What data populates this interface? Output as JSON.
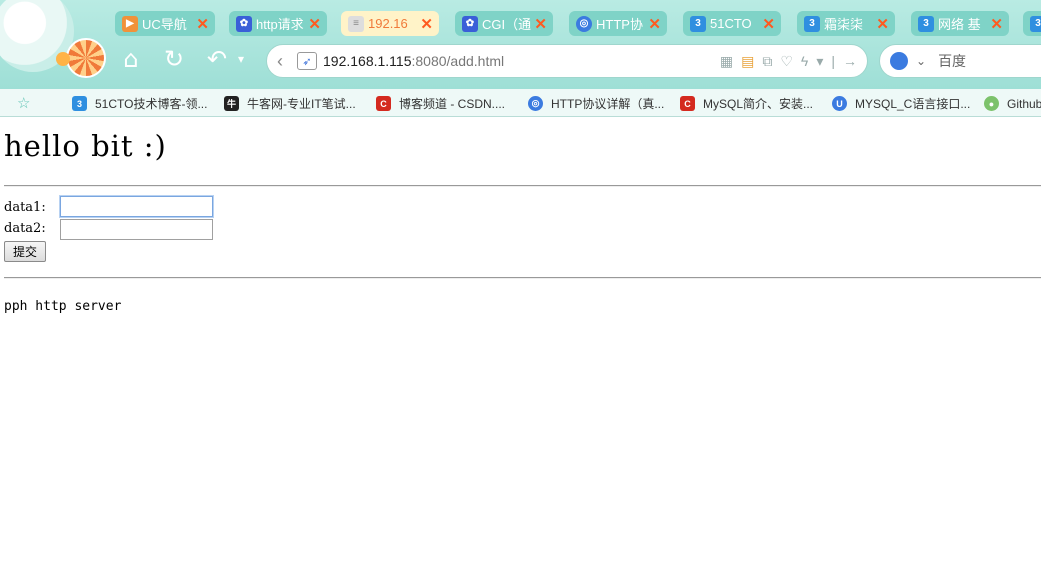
{
  "browser": {
    "tabs": [
      {
        "label": "UC导航",
        "icon": "uc-nav-icon",
        "color": "#f0923a",
        "active": false
      },
      {
        "label": "http请求",
        "icon": "baidu-paw-icon",
        "color": "#3a5fd8",
        "active": false
      },
      {
        "label": "192.16",
        "icon": "page-loading-icon",
        "color": "#dddddd",
        "active": true
      },
      {
        "label": "CGI（通",
        "icon": "baidu-paw-icon",
        "color": "#3a5fd8",
        "active": false
      },
      {
        "label": "HTTP协",
        "icon": "globe-icon",
        "color": "#3b7be0",
        "active": false
      },
      {
        "label": "51CTO",
        "icon": "cto-icon",
        "color": "#2f8fe0",
        "active": false
      },
      {
        "label": "霜柒柒",
        "icon": "cto-icon",
        "color": "#2f8fe0",
        "active": false
      },
      {
        "label": "网络 基",
        "icon": "cto-icon",
        "color": "#2f8fe0",
        "active": false
      }
    ],
    "tab_close_glyph": "✕",
    "address": {
      "host": "192.168.1.115",
      "rest": ":8080/add.html"
    },
    "search": {
      "engine": "百度"
    },
    "bookmarks": [
      {
        "label": "51CTO技术博客-领...",
        "icon": "cto-icon",
        "color": "#2f8fe0"
      },
      {
        "label": "牛客网-专业IT笔试...",
        "icon": "nowcoder-icon",
        "color": "#222222"
      },
      {
        "label": "博客频道 - CSDN....",
        "icon": "csdn-icon",
        "color": "#d42a1f"
      },
      {
        "label": "HTTP协议详解（真...",
        "icon": "globe-icon",
        "color": "#3b7be0"
      },
      {
        "label": "MySQL简介、安装...",
        "icon": "csdn-icon",
        "color": "#d42a1f"
      },
      {
        "label": "MYSQL_C语言接口...",
        "icon": "uc-icon",
        "color": "#3b7be0"
      },
      {
        "label": "Github",
        "icon": "github-icon",
        "color": "#7cc26b"
      }
    ]
  },
  "page": {
    "heading": "hello bit :)",
    "form": {
      "data1_label": "data1:",
      "data1_value": "",
      "data2_label": "data2:",
      "data2_value": "",
      "submit_label": "提交"
    },
    "footer": "pph http server"
  }
}
